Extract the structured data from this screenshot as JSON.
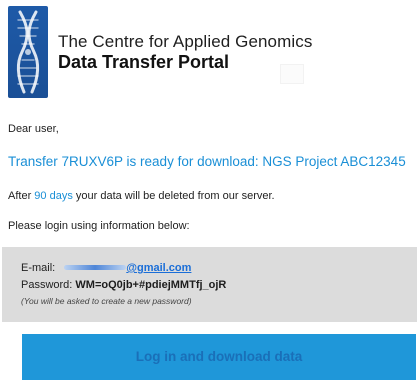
{
  "header": {
    "org_name": "The Centre for Applied Genomics",
    "portal_name": "Data Transfer Portal",
    "logo_icon": "chromosome-icon",
    "logo_color": "#1e5aa8"
  },
  "message": {
    "greeting": "Dear user,",
    "transfer_line": "Transfer 7RUXV6P is ready for download: NGS Project ABC12345",
    "retention_before": "After ",
    "retention_days": "90 days",
    "retention_after": " your data will be deleted from our server.",
    "login_info": "Please login using information below:"
  },
  "credentials": {
    "email_label": "E-mail: ",
    "email_domain": "@gmail.com",
    "password_label": "Password: ",
    "password_value": "WM=oQ0jb+#pdiejMMTfj_ojR",
    "note": "(You will be asked to create a new password)"
  },
  "actions": {
    "download_label": "Log in and download data"
  },
  "colors": {
    "link": "#1a8fd6",
    "button_bg": "#1f97d9",
    "credentials_bg": "#dcdcdc"
  }
}
